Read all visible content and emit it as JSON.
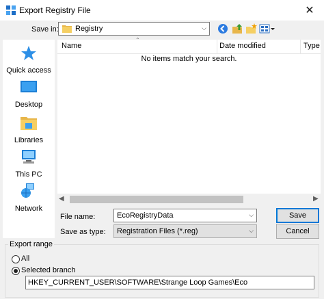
{
  "window": {
    "title": "Export Registry File",
    "close_glyph": "✕"
  },
  "save_in": {
    "label": "Save in:",
    "value": "Registry"
  },
  "places": [
    {
      "label": "Quick access"
    },
    {
      "label": "Desktop"
    },
    {
      "label": "Libraries"
    },
    {
      "label": "This PC"
    },
    {
      "label": "Network"
    }
  ],
  "file_list": {
    "columns": [
      "Name",
      "Date modified",
      "Type"
    ],
    "empty_message": "No items match your search."
  },
  "file_name": {
    "label": "File name:",
    "value": "EcoRegistryData"
  },
  "save_as_type": {
    "label": "Save as type:",
    "value": "Registration Files (*.reg)"
  },
  "buttons": {
    "save": "Save",
    "cancel": "Cancel"
  },
  "export_range": {
    "legend": "Export range",
    "all_label": "All",
    "selected_label": "Selected branch",
    "selected_value": "HKEY_CURRENT_USER\\SOFTWARE\\Strange Loop Games\\Eco"
  },
  "colors": {
    "accent": "#0078d7",
    "window_bg": "#f0f0f0"
  }
}
